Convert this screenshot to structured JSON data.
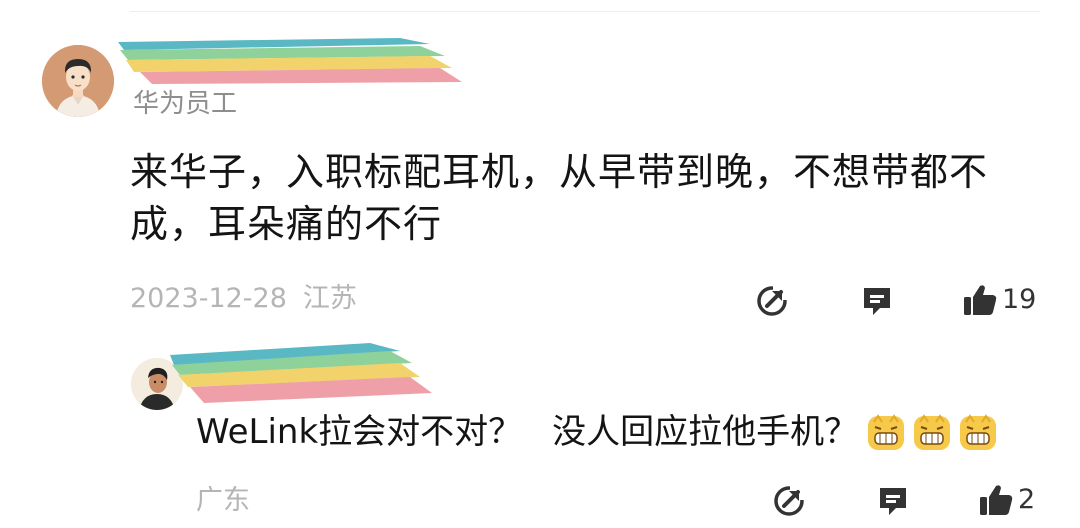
{
  "comment": {
    "badge": "华为员工",
    "text": "来华子，入职标配耳机，从早带到晚，不想带都不成，耳朵痛的不行",
    "date": "2023-12-28",
    "location": "江苏",
    "actions": {
      "share_icon": "share-icon",
      "reply_icon": "comment-icon",
      "like_icon": "thumbs-up-icon",
      "like_count": "19"
    }
  },
  "reply": {
    "text_part1": "WeLink拉会对不对？",
    "text_part2": "没人回应拉他手机？",
    "emojis": [
      "grinning-emoji",
      "grinning-emoji",
      "grinning-emoji"
    ],
    "location": "广东",
    "actions": {
      "share_icon": "share-icon",
      "reply_icon": "comment-icon",
      "like_icon": "thumbs-up-icon",
      "like_count": "2"
    }
  },
  "colors": {
    "redaction_teal": "#5ab8c4",
    "redaction_green": "#8fd19a",
    "redaction_yellow": "#f2d36b",
    "redaction_pink": "#ef9fa8",
    "icon_gray": "#333333",
    "meta_gray": "#b5b5b5"
  }
}
